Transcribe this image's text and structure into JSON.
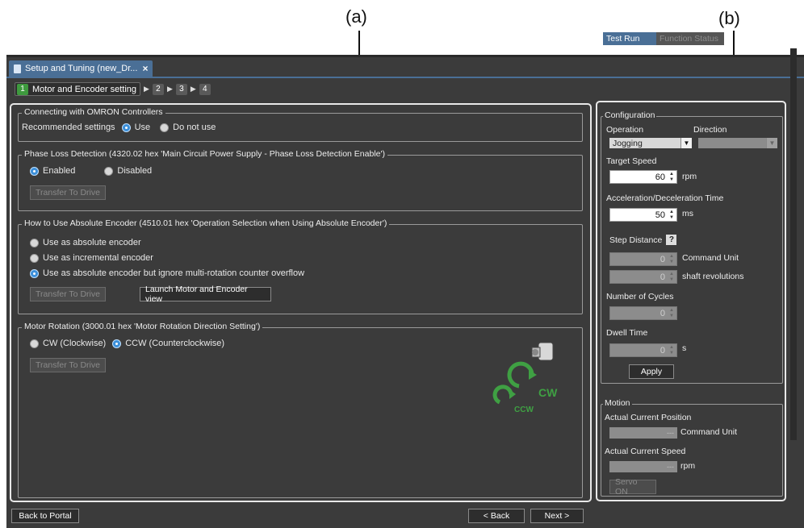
{
  "callouts": {
    "a": "(a)",
    "b": "(b)"
  },
  "window_tab": {
    "title": "Setup and Tuning (new_Dr...",
    "close": "×"
  },
  "steps": [
    {
      "num": "1",
      "label": "Motor and Encoder setting"
    },
    {
      "num": "2"
    },
    {
      "num": "3"
    },
    {
      "num": "4"
    }
  ],
  "omron": {
    "legend": "Connecting with OMRON Controllers",
    "label": "Recommended settings",
    "opt_use": "Use",
    "opt_notuse": "Do not use"
  },
  "phase": {
    "legend": "Phase Loss Detection (4320.02 hex 'Main Circuit Power Supply - Phase Loss Detection Enable')",
    "opt_enabled": "Enabled",
    "opt_disabled": "Disabled",
    "transfer": "Transfer To Drive"
  },
  "absenc": {
    "legend": "How to Use Absolute Encoder (4510.01 hex 'Operation Selection when Using Absolute Encoder')",
    "opt1": "Use as absolute encoder",
    "opt2": "Use as incremental encoder",
    "opt3": "Use as absolute encoder but ignore multi-rotation counter overflow",
    "transfer": "Transfer To Drive",
    "launch": "Launch Motor and Encoder view"
  },
  "rotation": {
    "legend": "Motor Rotation (3000.01 hex 'Motor Rotation Direction Setting')",
    "opt_cw": "CW (Clockwise)",
    "opt_ccw": "CCW (Counterclockwise)",
    "transfer": "Transfer To Drive",
    "img_cw": "CW",
    "img_ccw": "CCW"
  },
  "footer": {
    "back_portal": "Back to Portal",
    "back": "< Back",
    "next": "Next >"
  },
  "right_tabs": {
    "test_run": "Test Run",
    "function_status": "Function Status"
  },
  "config": {
    "legend": "Configuration",
    "operation_label": "Operation",
    "direction_label": "Direction",
    "operation_value": "Jogging",
    "target_speed_label": "Target Speed",
    "target_speed": "60",
    "rpm": "rpm",
    "accel_label": "Acceleration/Deceleration Time",
    "accel": "50",
    "ms": "ms",
    "step_label": "Step Distance",
    "help": "?",
    "step_value": "0",
    "command_unit": "Command Unit",
    "shaft_value": "0",
    "shaft_unit": "shaft revolutions",
    "cycles_label": "Number of Cycles",
    "cycles": "0",
    "dwell_label": "Dwell Time",
    "dwell": "0",
    "s": "s",
    "apply": "Apply"
  },
  "motion": {
    "legend": "Motion",
    "pos_label": "Actual Current Position",
    "pos_value": "---",
    "pos_unit": "Command Unit",
    "speed_label": "Actual Current Speed",
    "speed_value": "---",
    "speed_unit": "rpm",
    "servo_on": "Servo ON"
  },
  "colors": {
    "accent_green": "#3e9a3e",
    "tab_blue": "#4a6f96",
    "radio_on": "#3c8fd9"
  }
}
